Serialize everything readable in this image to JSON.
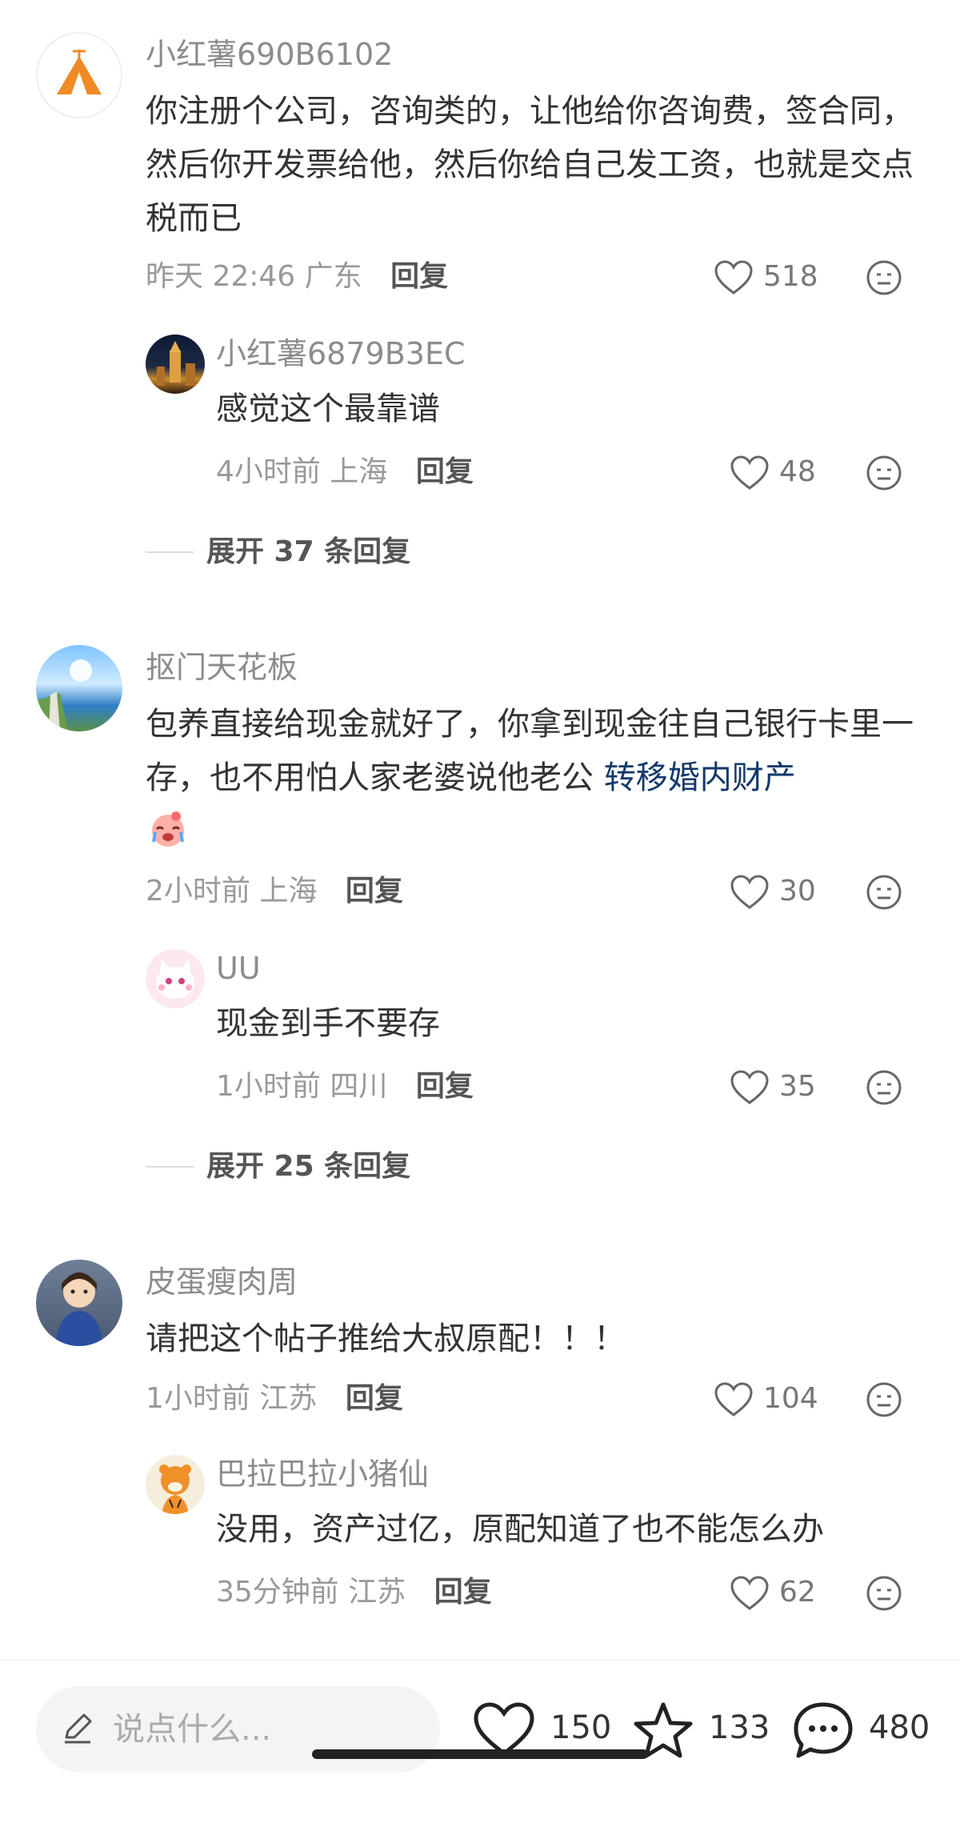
{
  "comments": [
    {
      "username": "小红薯690B6102",
      "avatar_icon": "orange-tent-avatar-icon",
      "content": "你注册个公司，咨询类的，让他给你咨询费，签合同，然后你开发票给他，然后你给自己发工资，也就是交点税而已",
      "time": "昨天 22:46",
      "location": "广东",
      "reply_label": "回复",
      "likes": "518",
      "reply": {
        "username": "小红薯6879B3EC",
        "avatar_icon": "night-city-avatar-icon",
        "content": "感觉这个最靠谱",
        "time": "4小时前",
        "location": "上海",
        "reply_label": "回复",
        "likes": "48"
      },
      "expand_label": "展开 37 条回复"
    },
    {
      "username": "抠门天花板",
      "avatar_icon": "seaside-cliff-avatar-icon",
      "content_prefix": "包养直接给现金就好了，你拿到现金往自己银行卡里一存，也不用怕人家老婆说他老公 ",
      "content_link": "转移婚内财产",
      "emoji_icon": "crying-face-emoji-icon",
      "time": "2小时前",
      "location": "上海",
      "reply_label": "回复",
      "likes": "30",
      "reply": {
        "username": "UU",
        "avatar_icon": "pink-cat-avatar-icon",
        "content": "现金到手不要存",
        "time": "1小时前",
        "location": "四川",
        "reply_label": "回复",
        "likes": "35"
      },
      "expand_label": "展开 25 条回复"
    },
    {
      "username": "皮蛋瘦肉周",
      "avatar_icon": "portrait-lady-avatar-icon",
      "content": "请把这个帖子推给大叔原配！！！",
      "time": "1小时前",
      "location": "江苏",
      "reply_label": "回复",
      "likes": "104",
      "reply": {
        "username": "巴拉巴拉小猪仙",
        "avatar_icon": "tiger-cartoon-avatar-icon",
        "content": "没用，资产过亿，原配知道了也不能怎么办",
        "time": "35分钟前",
        "location": "江苏",
        "reply_label": "回复",
        "likes": "62"
      }
    }
  ],
  "bottom_bar": {
    "input_placeholder": "说点什么...",
    "likes": "150",
    "favorites": "133",
    "comments": "480"
  },
  "colors": {
    "username": "#8c8c8c",
    "content": "#333333",
    "meta": "#999999",
    "link": "#13386c",
    "avatar_tent": "#f08a24"
  }
}
